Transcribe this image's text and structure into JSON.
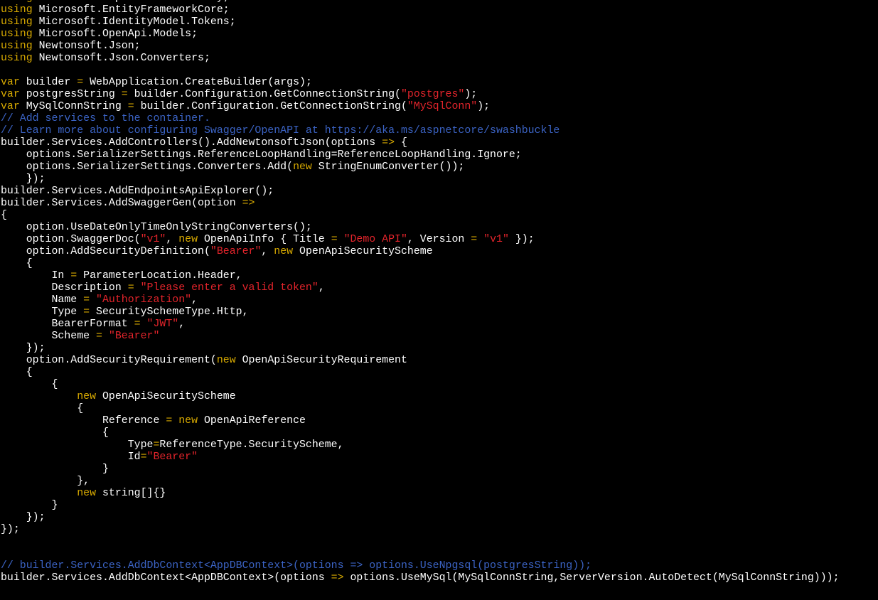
{
  "colors": {
    "background": "#000000",
    "plain": "#ffffff",
    "keyword": "#d7a900",
    "string": "#e3242b",
    "comment": "#3b63c4"
  },
  "lines": [
    [
      [
        "kw",
        "using"
      ],
      [
        "p",
        " Microsoft.AspNetCore.Identity;"
      ]
    ],
    [
      [
        "kw",
        "using"
      ],
      [
        "p",
        " Microsoft.EntityFrameworkCore;"
      ]
    ],
    [
      [
        "kw",
        "using"
      ],
      [
        "p",
        " Microsoft.IdentityModel.Tokens;"
      ]
    ],
    [
      [
        "kw",
        "using"
      ],
      [
        "p",
        " Microsoft.OpenApi.Models;"
      ]
    ],
    [
      [
        "kw",
        "using"
      ],
      [
        "p",
        " Newtonsoft.Json;"
      ]
    ],
    [
      [
        "kw",
        "using"
      ],
      [
        "p",
        " Newtonsoft.Json.Converters;"
      ]
    ],
    [],
    [
      [
        "kw",
        "var"
      ],
      [
        "p",
        " builder "
      ],
      [
        "kw",
        "="
      ],
      [
        "p",
        " WebApplication.CreateBuilder(args);"
      ]
    ],
    [
      [
        "kw",
        "var"
      ],
      [
        "p",
        " postgresString "
      ],
      [
        "kw",
        "="
      ],
      [
        "p",
        " builder.Configuration.GetConnectionString("
      ],
      [
        "s",
        "\"postgres\""
      ],
      [
        "p",
        ");"
      ]
    ],
    [
      [
        "kw",
        "var"
      ],
      [
        "p",
        " MySqlConnString "
      ],
      [
        "kw",
        "="
      ],
      [
        "p",
        " builder.Configuration.GetConnectionString("
      ],
      [
        "s",
        "\"MySqlConn\""
      ],
      [
        "p",
        ");"
      ]
    ],
    [
      [
        "c",
        "// Add services to the container."
      ]
    ],
    [
      [
        "c",
        "// Learn more about configuring Swagger/OpenAPI at https://aka.ms/aspnetcore/swashbuckle"
      ]
    ],
    [
      [
        "p",
        "builder.Services.AddControllers().AddNewtonsoftJson(options "
      ],
      [
        "kw",
        "=>"
      ],
      [
        "p",
        " {"
      ]
    ],
    [
      [
        "p",
        "    options.SerializerSettings.ReferenceLoopHandling=ReferenceLoopHandling.Ignore;"
      ]
    ],
    [
      [
        "p",
        "    options.SerializerSettings.Converters.Add("
      ],
      [
        "kw",
        "new"
      ],
      [
        "p",
        " StringEnumConverter());"
      ]
    ],
    [
      [
        "p",
        "    });"
      ]
    ],
    [
      [
        "p",
        "builder.Services.AddEndpointsApiExplorer();"
      ]
    ],
    [
      [
        "p",
        "builder.Services.AddSwaggerGen(option "
      ],
      [
        "kw",
        "=>"
      ]
    ],
    [
      [
        "p",
        "{"
      ]
    ],
    [
      [
        "p",
        "    option.UseDateOnlyTimeOnlyStringConverters();"
      ]
    ],
    [
      [
        "p",
        "    option.SwaggerDoc("
      ],
      [
        "s",
        "\"v1\""
      ],
      [
        "p",
        ", "
      ],
      [
        "kw",
        "new"
      ],
      [
        "p",
        " OpenApiInfo { Title "
      ],
      [
        "kw",
        "="
      ],
      [
        "p",
        " "
      ],
      [
        "s",
        "\"Demo API\""
      ],
      [
        "p",
        ", Version "
      ],
      [
        "kw",
        "="
      ],
      [
        "p",
        " "
      ],
      [
        "s",
        "\"v1\""
      ],
      [
        "p",
        " });"
      ]
    ],
    [
      [
        "p",
        "    option.AddSecurityDefinition("
      ],
      [
        "s",
        "\"Bearer\""
      ],
      [
        "p",
        ", "
      ],
      [
        "kw",
        "new"
      ],
      [
        "p",
        " OpenApiSecurityScheme"
      ]
    ],
    [
      [
        "p",
        "    {"
      ]
    ],
    [
      [
        "p",
        "        In "
      ],
      [
        "kw",
        "="
      ],
      [
        "p",
        " ParameterLocation.Header,"
      ]
    ],
    [
      [
        "p",
        "        Description "
      ],
      [
        "kw",
        "="
      ],
      [
        "p",
        " "
      ],
      [
        "s",
        "\"Please enter a valid token\""
      ],
      [
        "p",
        ","
      ]
    ],
    [
      [
        "p",
        "        Name "
      ],
      [
        "kw",
        "="
      ],
      [
        "p",
        " "
      ],
      [
        "s",
        "\"Authorization\""
      ],
      [
        "p",
        ","
      ]
    ],
    [
      [
        "p",
        "        Type "
      ],
      [
        "kw",
        "="
      ],
      [
        "p",
        " SecuritySchemeType.Http,"
      ]
    ],
    [
      [
        "p",
        "        BearerFormat "
      ],
      [
        "kw",
        "="
      ],
      [
        "p",
        " "
      ],
      [
        "s",
        "\"JWT\""
      ],
      [
        "p",
        ","
      ]
    ],
    [
      [
        "p",
        "        Scheme "
      ],
      [
        "kw",
        "="
      ],
      [
        "p",
        " "
      ],
      [
        "s",
        "\"Bearer\""
      ]
    ],
    [
      [
        "p",
        "    });"
      ]
    ],
    [
      [
        "p",
        "    option.AddSecurityRequirement("
      ],
      [
        "kw",
        "new"
      ],
      [
        "p",
        " OpenApiSecurityRequirement"
      ]
    ],
    [
      [
        "p",
        "    {"
      ]
    ],
    [
      [
        "p",
        "        {"
      ]
    ],
    [
      [
        "p",
        "            "
      ],
      [
        "kw",
        "new"
      ],
      [
        "p",
        " OpenApiSecurityScheme"
      ]
    ],
    [
      [
        "p",
        "            {"
      ]
    ],
    [
      [
        "p",
        "                Reference "
      ],
      [
        "kw",
        "="
      ],
      [
        "p",
        " "
      ],
      [
        "kw",
        "new"
      ],
      [
        "p",
        " OpenApiReference"
      ]
    ],
    [
      [
        "p",
        "                {"
      ]
    ],
    [
      [
        "p",
        "                    Type"
      ],
      [
        "kw",
        "="
      ],
      [
        "p",
        "ReferenceType.SecurityScheme,"
      ]
    ],
    [
      [
        "p",
        "                    Id"
      ],
      [
        "kw",
        "="
      ],
      [
        "s",
        "\"Bearer\""
      ]
    ],
    [
      [
        "p",
        "                }"
      ]
    ],
    [
      [
        "p",
        "            },"
      ]
    ],
    [
      [
        "p",
        "            "
      ],
      [
        "kw",
        "new"
      ],
      [
        "p",
        " string[]{}"
      ]
    ],
    [
      [
        "p",
        "        }"
      ]
    ],
    [
      [
        "p",
        "    });"
      ]
    ],
    [
      [
        "p",
        "});"
      ]
    ],
    [],
    [],
    [
      [
        "c",
        "// builder.Services.AddDbContext<AppDBContext>(options => options.UseNpgsql(postgresString));"
      ]
    ],
    [
      [
        "p",
        "builder.Services.AddDbContext<AppDBContext>(options "
      ],
      [
        "kw",
        "=>"
      ],
      [
        "p",
        " options.UseMySql(MySqlConnString,ServerVersion.AutoDetect(MySqlConnString)));"
      ]
    ]
  ]
}
